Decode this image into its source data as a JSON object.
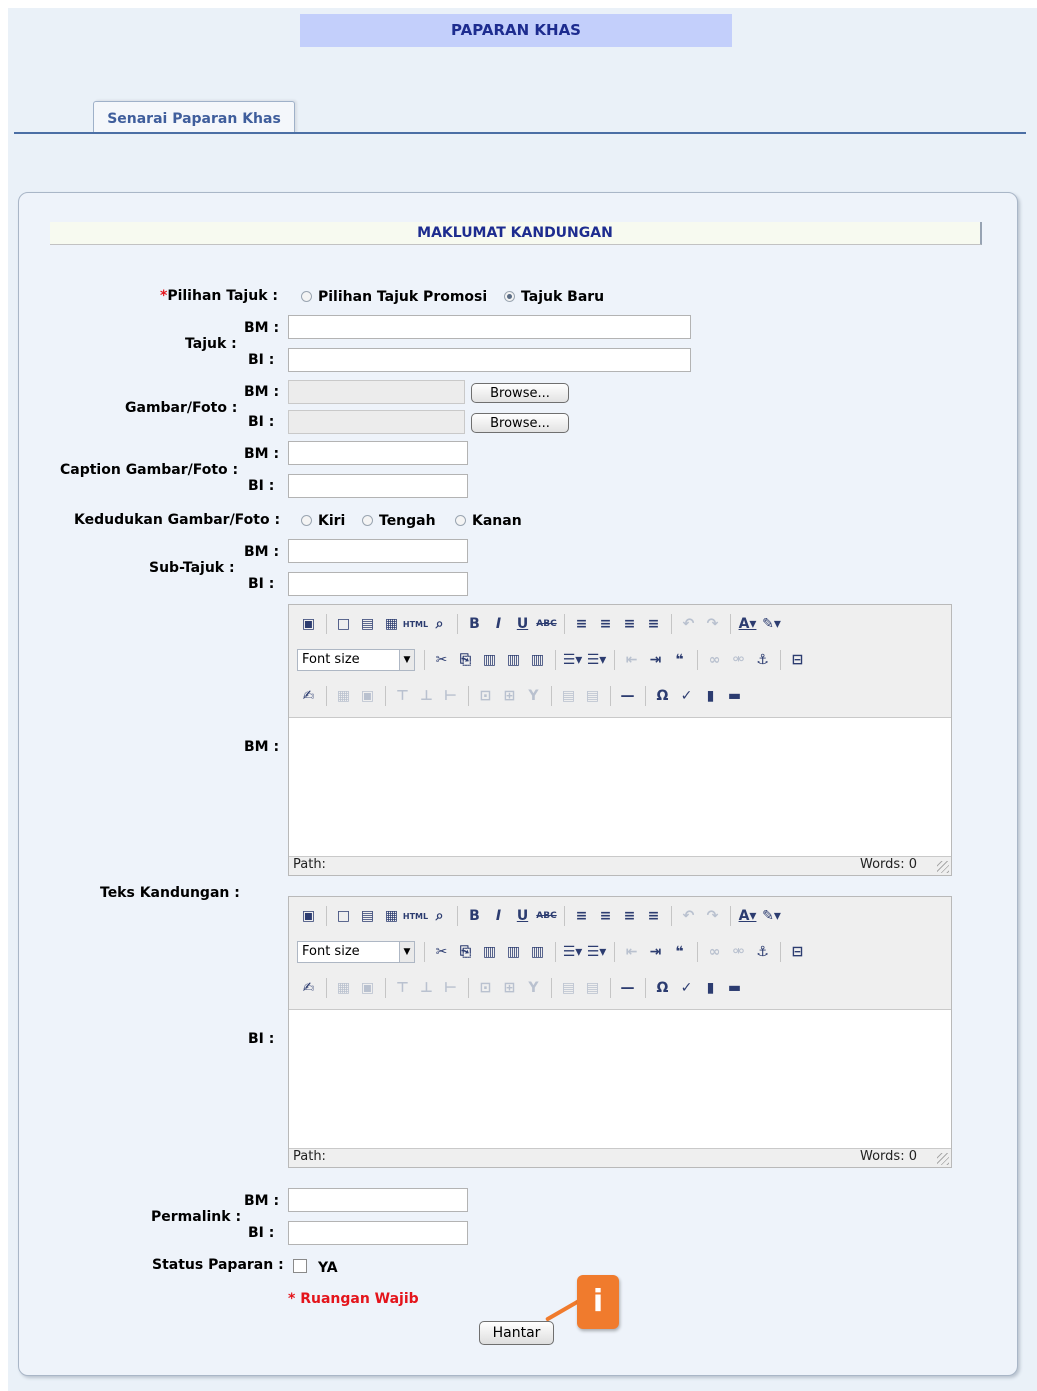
{
  "page": {
    "title": "PAPARAN KHAS",
    "tab": "Senarai Paparan Khas"
  },
  "section": {
    "title": "MAKLUMAT KANDUNGAN"
  },
  "common": {
    "bm": "BM :",
    "bi": "BI :",
    "browse": "Browse..."
  },
  "fields": {
    "pilihan_tajuk": {
      "required_mark": "*",
      "label": "Pilihan Tajuk :",
      "options": [
        "Pilihan Tajuk Promosi",
        "Tajuk Baru"
      ],
      "selected": "Tajuk Baru"
    },
    "tajuk": {
      "label": "Tajuk :"
    },
    "gambar": {
      "label": "Gambar/Foto :"
    },
    "caption": {
      "label": "Caption Gambar/Foto :"
    },
    "kedudukan": {
      "label": "Kedudukan Gambar/Foto :",
      "options": [
        "Kiri",
        "Tengah",
        "Kanan"
      ]
    },
    "sub_tajuk": {
      "label": "Sub-Tajuk :"
    },
    "teks": {
      "label": "Teks Kandungan :"
    },
    "permalink": {
      "label": "Permalink :"
    },
    "status": {
      "label": "Status Paparan :",
      "option": "YA"
    }
  },
  "editor": {
    "font_size_placeholder": "Font size",
    "path_label": "Path:",
    "words_label": "Words: 0"
  },
  "footer": {
    "required_note": "* Ruangan Wajib",
    "submit": "Hantar",
    "info_badge": "i"
  },
  "colors": {
    "header_bg": "#c3cffb",
    "title_text": "#1d2c8f",
    "required": "#e4141b",
    "badge": "#f07b2d"
  }
}
